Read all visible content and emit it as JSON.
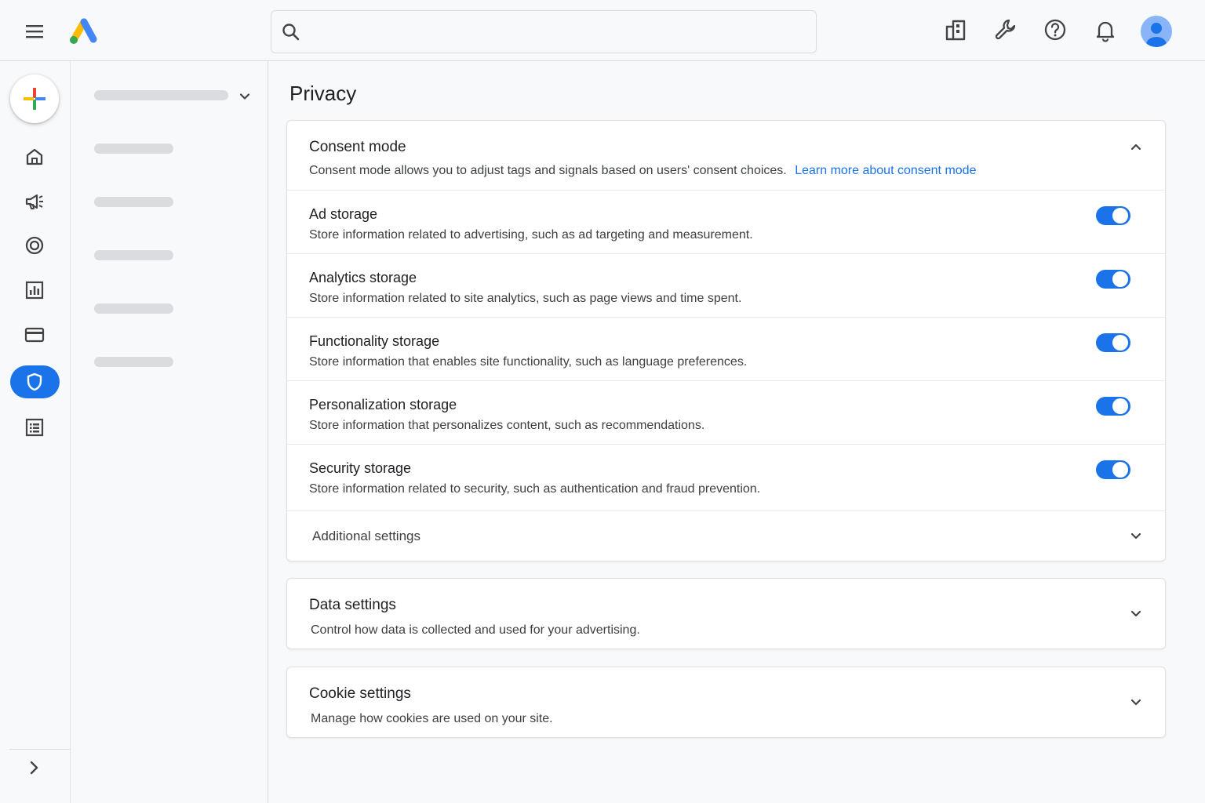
{
  "app": {
    "search": {
      "value": "",
      "placeholder": ""
    }
  },
  "colors": {
    "accent": "#1a73e8",
    "logo_blue": "#4285f4",
    "logo_yellow": "#fbbc04",
    "logo_green": "#34a853",
    "logo_red": "#ea4335"
  },
  "icons": {
    "topbar": [
      "menu-icon",
      "google-ads-logo",
      "search-icon",
      "building-icon",
      "wrench-icon",
      "help-icon",
      "bell-icon",
      "account-avatar"
    ],
    "rail": [
      "create-plus-icon",
      "home-icon",
      "campaigns-megaphone-icon",
      "goals-target-icon",
      "insights-chart-icon",
      "billing-card-icon",
      "admin-shield-icon",
      "tools-list-icon",
      "expand-chevron-icon"
    ]
  },
  "page": {
    "title": "Privacy"
  },
  "consent": {
    "title": "Consent mode",
    "description": "Consent mode allows you to adjust tags and signals based on users' consent choices.",
    "link": "Learn more about consent mode",
    "expanded": true,
    "settings": [
      {
        "title": "Ad storage",
        "description": "Store information related to advertising, such as ad targeting and measurement.",
        "enabled": true
      },
      {
        "title": "Analytics storage",
        "description": "Store information related to site analytics, such as page views and time spent.",
        "enabled": true
      },
      {
        "title": "Functionality storage",
        "description": "Store information that enables site functionality, such as language preferences.",
        "enabled": true
      },
      {
        "title": "Personalization storage",
        "description": "Store information that personalizes content, such as recommendations.",
        "enabled": true
      },
      {
        "title": "Security storage",
        "description": "Store information related to security, such as authentication and fraud prevention.",
        "enabled": true
      }
    ],
    "additional": "Additional settings"
  },
  "data_settings": {
    "title": "Data settings",
    "description": "Control how data is collected and used for your advertising."
  },
  "cookie_settings": {
    "title": "Cookie settings",
    "description": "Manage how cookies are used on your site."
  }
}
